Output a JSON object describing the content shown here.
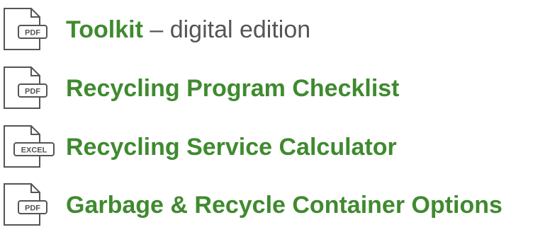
{
  "colors": {
    "link_green": "#3f8a2f",
    "secondary_text": "#555555",
    "icon_stroke": "#555555"
  },
  "documents": [
    {
      "title": "Toolkit",
      "suffix": " – digital edition",
      "file_type": "PDF",
      "icon": "pdf-file-icon"
    },
    {
      "title": "Recycling Program Checklist",
      "suffix": "",
      "file_type": "PDF",
      "icon": "pdf-file-icon"
    },
    {
      "title": "Recycling Service Calculator",
      "suffix": "",
      "file_type": "EXCEL",
      "icon": "excel-file-icon"
    },
    {
      "title": "Garbage & Recycle Container Options",
      "suffix": "",
      "file_type": "PDF",
      "icon": "pdf-file-icon"
    }
  ]
}
